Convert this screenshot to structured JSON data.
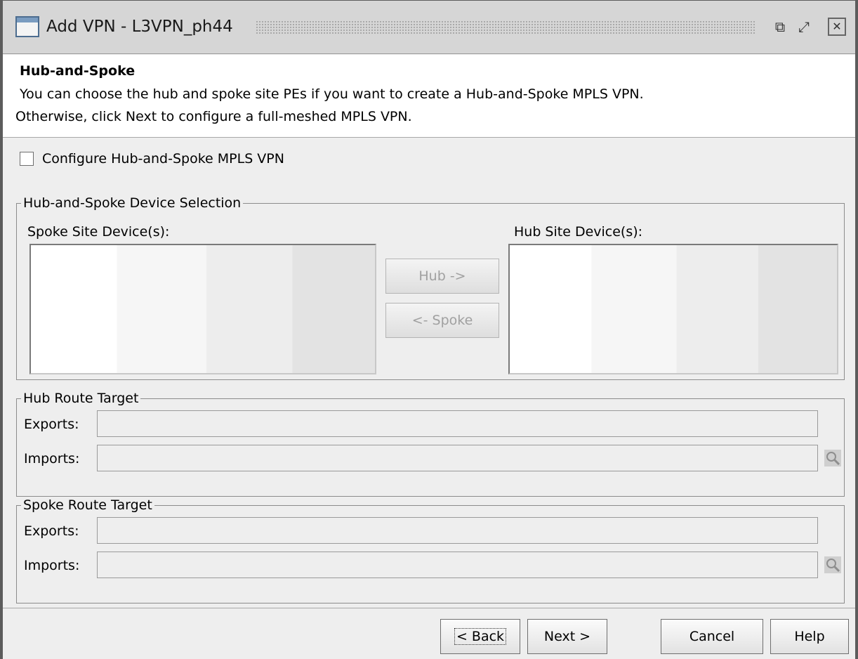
{
  "window": {
    "title": "Add VPN - L3VPN_ph44",
    "minimize_glyph": "⧉",
    "maximize_glyph": "⤢",
    "close_glyph": "✕"
  },
  "header": {
    "title": "Hub-and-Spoke",
    "description_line1": " You can choose the hub and spoke site PEs if you want to create a Hub-and-Spoke MPLS VPN.",
    "description_line2": "Otherwise, click Next to configure a full-meshed MPLS VPN."
  },
  "configure_checkbox": {
    "label": "Configure Hub-and-Spoke MPLS VPN",
    "checked": false
  },
  "device_selection": {
    "legend": "Hub-and-Spoke Device Selection",
    "spoke_label": "Spoke Site Device(s):",
    "hub_label": "Hub Site Device(s):",
    "to_hub_button": "Hub ->",
    "to_spoke_button": "<- Spoke",
    "spoke_devices": [],
    "hub_devices": []
  },
  "hub_route_target": {
    "legend": "Hub Route Target",
    "exports_label": "Exports:",
    "exports_value": "",
    "imports_label": "Imports:",
    "imports_value": ""
  },
  "spoke_route_target": {
    "legend": "Spoke Route Target",
    "exports_label": "Exports:",
    "exports_value": "",
    "imports_label": "Imports:",
    "imports_value": ""
  },
  "footer": {
    "back": "< Back",
    "next": "Next >",
    "cancel": "Cancel",
    "help": "Help"
  },
  "icons": {
    "window_icon": "window-icon",
    "lookup": "magnifier-icon"
  }
}
